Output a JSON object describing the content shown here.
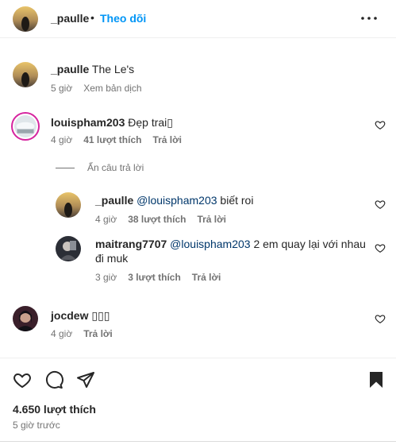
{
  "header": {
    "username": "_paulle",
    "dot": "•",
    "follow_label": "Theo dõi"
  },
  "caption": {
    "username": "_paulle",
    "text": "The Le's",
    "time": "5 giờ",
    "translate": "Xem bản dịch"
  },
  "comments": [
    {
      "username": "louispham203",
      "text": "Đẹp trai",
      "emoji": "▯",
      "time": "4 giờ",
      "likes": "41 lượt thích",
      "reply": "Trả lời"
    },
    {
      "username": "jocdew",
      "text": "▯▯▯",
      "time": "4 giờ",
      "reply": "Trả lời"
    }
  ],
  "hide_replies": "Ẩn câu trả lời",
  "replies": [
    {
      "username": "_paulle",
      "mention": "@louispham203",
      "text": "biết roi",
      "time": "4 giờ",
      "likes": "38 lượt thích",
      "reply": "Trả lời"
    },
    {
      "username": "maitrang7707",
      "mention": "@louispham203",
      "text_line1": "2 em quay lại với nhau",
      "text_line2": "đi muk",
      "time": "3 giờ",
      "likes": "3 lượt thích",
      "reply": "Trả lời"
    }
  ],
  "footer": {
    "likes": "4.650 lượt thích",
    "time": "5 giờ trước"
  },
  "colors": {
    "accent": "#0095f6",
    "mention": "#00376b",
    "secondary_text": "#737373"
  },
  "icons": [
    "more-icon",
    "heart-icon",
    "comment-icon",
    "share-icon",
    "bookmark-icon"
  ]
}
